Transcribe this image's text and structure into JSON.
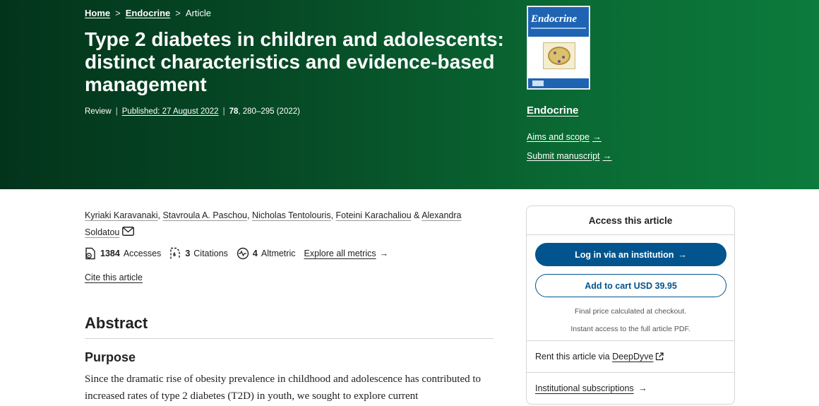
{
  "breadcrumb": {
    "home": "Home",
    "journal": "Endocrine",
    "current": "Article",
    "separator": ">"
  },
  "article": {
    "title": "Type 2 diabetes in children and adolescents: distinct characteristics and evidence-based management",
    "type": "Review",
    "published": "Published: 27 August 2022",
    "volume": "78",
    "pages": ", 280–295 (2022)"
  },
  "journal": {
    "name": "Endocrine",
    "cover_title": "Endocrine",
    "aims_scope": "Aims and scope",
    "submit": "Submit manuscript"
  },
  "authors": {
    "list": [
      "Kyriaki Karavanaki",
      "Stavroula A. Paschou",
      "Nicholas Tentolouris",
      "Foteini Karachaliou"
    ],
    "last_first": "Alexandra",
    "last_second": "Soldatou",
    "conjunction": "&"
  },
  "metrics": {
    "accesses_count": "1384",
    "accesses_label": "Accesses",
    "citations_count": "3",
    "citations_label": "Citations",
    "altmetric_count": "4",
    "altmetric_label": "Altmetric",
    "explore": "Explore all metrics"
  },
  "cite_label": "Cite this article",
  "abstract": {
    "heading": "Abstract",
    "subheading": "Purpose",
    "text": "Since the dramatic rise of obesity prevalence in childhood and adolescence has contributed to increased rates of type 2 diabetes (T2D) in youth, we sought to explore current"
  },
  "access": {
    "heading": "Access this article",
    "login": "Log in via an institution",
    "add_to_cart": "Add to cart USD 39.95",
    "note_price": "Final price calculated at checkout.",
    "note_access": "Instant access to the full article PDF.",
    "rent_prefix": "Rent this article via",
    "rent_link": "DeepDyve",
    "subscriptions": "Institutional subscriptions"
  },
  "colors": {
    "hero_dark": "#03341b",
    "hero_light": "#0c7b3c",
    "primary_button": "#01548d"
  }
}
